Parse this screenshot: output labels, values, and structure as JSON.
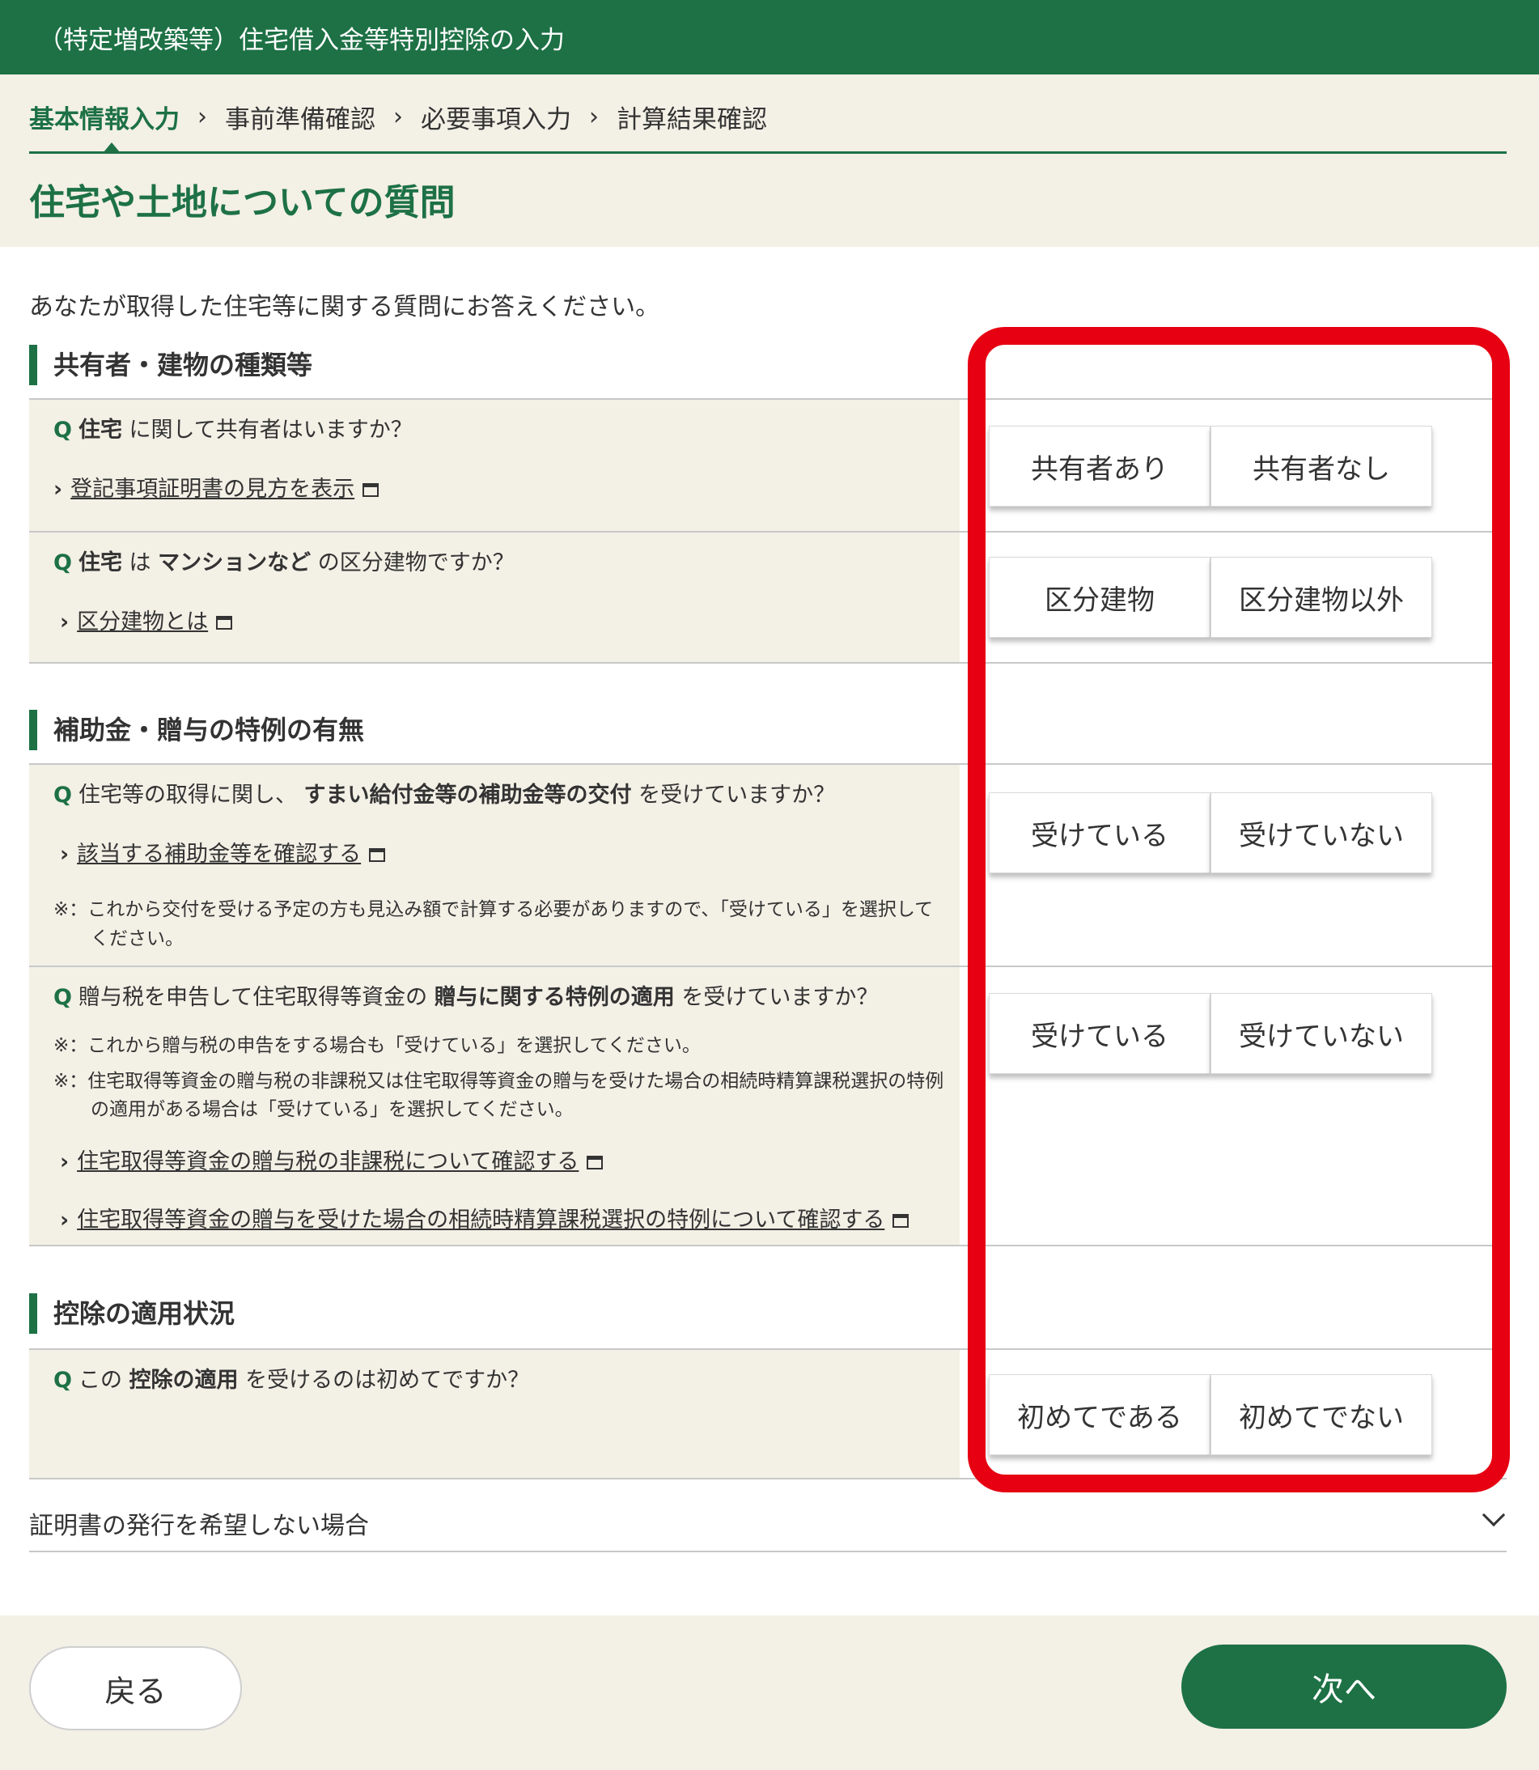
{
  "window": {
    "title": "（特定増改築等）住宅借入金等特別控除の入力"
  },
  "steps": [
    {
      "label": "基本情報入力",
      "active": true
    },
    {
      "label": "事前準備確認",
      "active": false
    },
    {
      "label": "必要事項入力",
      "active": false
    },
    {
      "label": "計算結果確認",
      "active": false
    }
  ],
  "page_title": "住宅や土地についての質問",
  "intro": "あなたが取得した住宅等に関する質問にお答えください。",
  "sections": {
    "s1": {
      "heading": "共有者・建物の種類等"
    },
    "s2": {
      "heading": "補助金・贈与の特例の有無"
    },
    "s3": {
      "heading": "控除の適用状況"
    }
  },
  "q1": {
    "q_mark": "Q",
    "part1": "住宅",
    "part2": " に関して共有者はいますか？",
    "link": "登記事項証明書の見方を表示",
    "yes": "共有者あり",
    "no": "共有者なし"
  },
  "q2": {
    "q_mark": "Q",
    "part1": "住宅",
    "part2": " は ",
    "part3": "マンションなど",
    "part4": " の区分建物ですか？",
    "link": "区分建物とは",
    "yes": "区分建物",
    "no": "区分建物以外"
  },
  "q3": {
    "q_mark": "Q",
    "part1": "住宅等の取得に関し、 ",
    "part2": "すまい給付金等の補助金等の交付",
    "part3": " を受けていますか？",
    "link": "該当する補助金等を確認する",
    "note1": "※：これから交付を受ける予定の方も見込み額で計算する必要がありますので、「受けている」を選択して",
    "note2": "ください。",
    "yes": "受けている",
    "no": "受けていない"
  },
  "q4": {
    "q_mark": "Q",
    "part1": "贈与税を申告して住宅取得等資金の ",
    "part2": "贈与に関する特例の適用",
    "part3": " を受けていますか？",
    "note1": "※：これから贈与税の申告をする場合も「受けている」を選択してください。",
    "note2a": "※：住宅取得等資金の贈与税の非課税又は住宅取得等資金の贈与を受けた場合の相続時精算課税選択の特例",
    "note2b": "の適用がある場合は「受けている」を選択してください。",
    "link1": "住宅取得等資金の贈与税の非課税について確認する",
    "link2": "住宅取得等資金の贈与を受けた場合の相続時精算課税選択の特例について確認する",
    "yes": "受けている",
    "no": "受けていない"
  },
  "q5": {
    "q_mark": "Q",
    "part1": "この ",
    "part2": "控除の適用",
    "part3": " を受けるのは初めてですか？",
    "yes": "初めてである",
    "no": "初めてでない"
  },
  "collapsible": {
    "label": "証明書の発行を希望しない場合"
  },
  "footer": {
    "back": "戻る",
    "next": "次へ"
  },
  "colors": {
    "brand_green": "#1d7145",
    "beige": "#f3f0e6",
    "highlight_red": "#e60012"
  }
}
